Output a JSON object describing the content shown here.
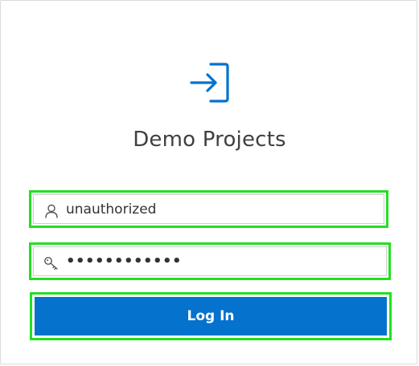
{
  "app": {
    "title": "Demo Projects",
    "header_icon": "sign-in-icon"
  },
  "username": {
    "icon": "user-icon",
    "value": "unauthorized"
  },
  "password": {
    "icon": "key-icon",
    "value": "••••••••••••"
  },
  "login_button": {
    "label": "Log In"
  },
  "colors": {
    "accent": "#0572ce",
    "highlight": "#22e022",
    "title_text": "#404040",
    "border": "#dcdcdc"
  }
}
